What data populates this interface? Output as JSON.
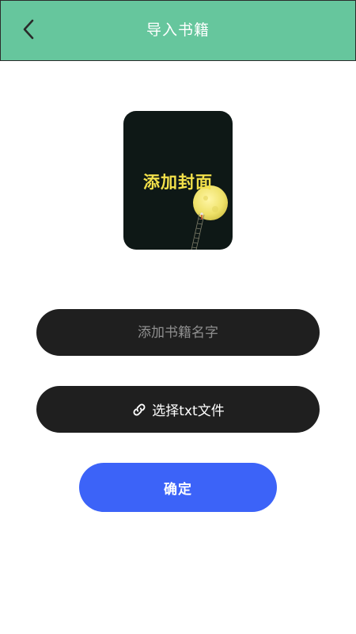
{
  "header": {
    "title": "导入书籍",
    "back_icon": "chevron-left-icon",
    "background": "#66c69d"
  },
  "cover": {
    "label": "添加封面",
    "label_color": "#f2e04a",
    "background": "#0e1816"
  },
  "form": {
    "name_placeholder": "添加书籍名字",
    "name_value": "",
    "file_button_label": "选择txt文件",
    "file_button_icon": "link-icon",
    "confirm_label": "确定",
    "confirm_color": "#3c63f8"
  }
}
